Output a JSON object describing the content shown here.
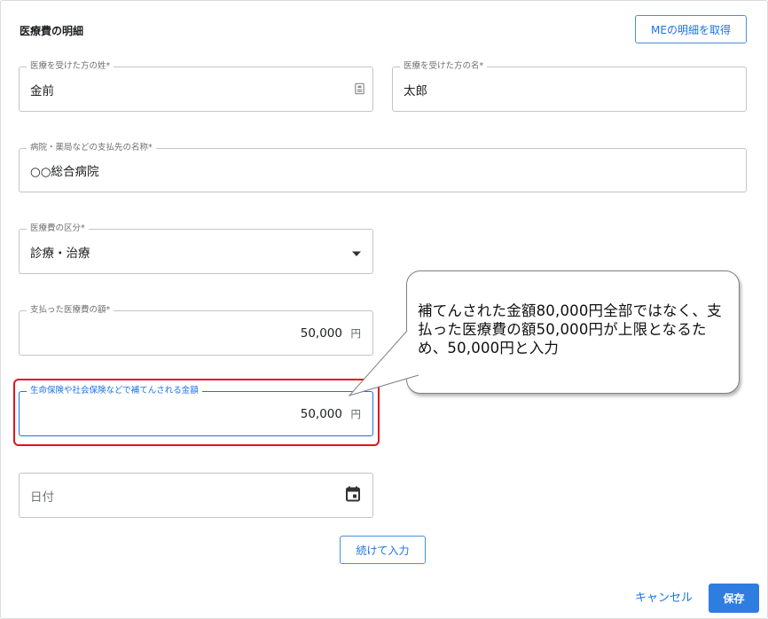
{
  "dialog": {
    "title": "医療費の明細",
    "fetch_button": "MEの明細を取得"
  },
  "fields": {
    "last_name": {
      "label": "医療を受けた方の姓*",
      "value": "金前"
    },
    "first_name": {
      "label": "医療を受けた方の名*",
      "value": "太郎"
    },
    "provider": {
      "label": "病院・薬局などの支払先の名称*",
      "value": "○○総合病院"
    },
    "category": {
      "label": "医療費の区分*",
      "value": "診療・治療"
    },
    "paid_amount": {
      "label": "支払った医療費の額*",
      "value": "50,000",
      "unit": "円"
    },
    "reimbursed_amount": {
      "label": "生命保険や社会保険などで補てんされる金額",
      "value": "50,000",
      "unit": "円"
    },
    "date": {
      "placeholder": "日付"
    }
  },
  "continue_button": "続けて入力",
  "footer": {
    "cancel": "キャンセル",
    "save": "保存"
  },
  "callout": {
    "text": "補てんされた金額80,000円全部ではなく、支払った医療費の額50,000円が上限となるため、50,000円と入力"
  },
  "colors": {
    "accent": "#1a73e8",
    "highlight": "#e0141e",
    "save_bg": "#2f7de1"
  }
}
